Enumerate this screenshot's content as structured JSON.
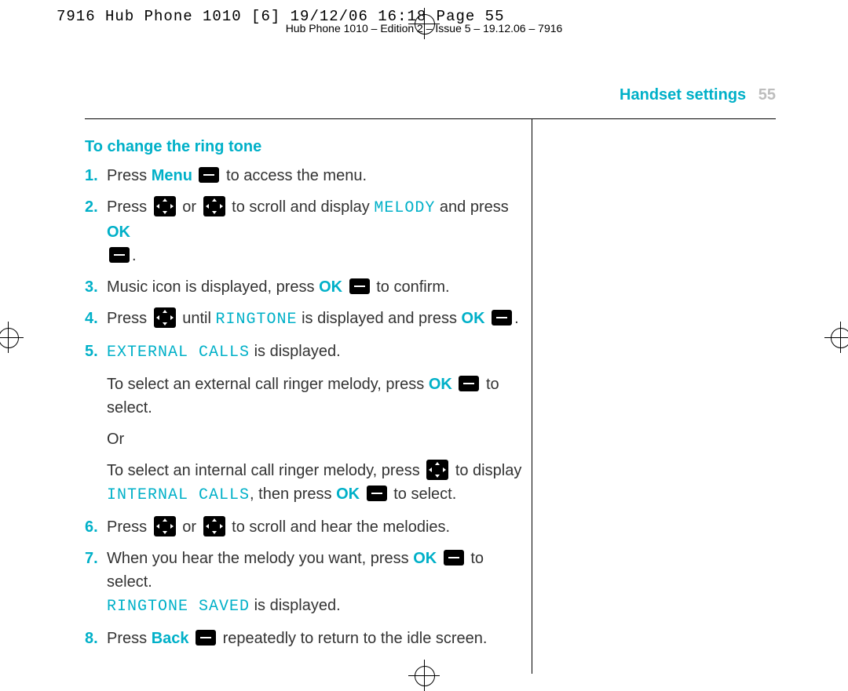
{
  "slug": "7916 Hub Phone 1010 [6]  19/12/06  16:18  Page 55",
  "running_header": "Hub Phone 1010 – Edition 2 – Issue 5 – 19.12.06 – 7916",
  "header": {
    "title": "Handset settings",
    "page_number": "55"
  },
  "section_title": "To change the ring tone",
  "steps": {
    "s1_a": "Press ",
    "s1_menu": "Menu",
    "s1_b": " to access the menu.",
    "s2_a": "Press ",
    "s2_or": " or ",
    "s2_b": " to scroll and display ",
    "s2_lcd": "MELODY",
    "s2_c": " and press ",
    "s2_ok": "OK",
    "s3_a": "Music icon is displayed, press ",
    "s3_ok": "OK",
    "s3_b": " to confirm.",
    "s4_a": "Press ",
    "s4_until": " until ",
    "s4_lcd": "RINGTONE",
    "s4_b": " is displayed and press ",
    "s4_ok": "OK",
    "s5_lcd": "EXTERNAL CALLS",
    "s5_a": " is displayed.",
    "s5sub1_a": "To select an external call ringer melody, press ",
    "s5sub1_ok": "OK",
    "s5sub1_b": " to select.",
    "s5sub_or": "Or",
    "s5sub2_a": "To select an internal call ringer melody, press ",
    "s5sub2_b": " to display ",
    "s5sub2_lcd": "INTERNAL CALLS",
    "s5sub2_c": ", then press ",
    "s5sub2_ok": "OK",
    "s5sub2_d": " to select.",
    "s6_a": "Press ",
    "s6_or": " or ",
    "s6_b": " to scroll and hear the melodies.",
    "s7_a": "When you hear the melody you want, press ",
    "s7_ok": "OK",
    "s7_b": " to select. ",
    "s7_lcd": "RINGTONE SAVED",
    "s7_c": " is displayed.",
    "s8_a": "Press ",
    "s8_back": "Back",
    "s8_b": " repeatedly to return to the idle screen."
  },
  "nums": {
    "n1": "1.",
    "n2": "2.",
    "n3": "3.",
    "n4": "4.",
    "n5": "5.",
    "n6": "6.",
    "n7": "7.",
    "n8": "8."
  },
  "period": "."
}
